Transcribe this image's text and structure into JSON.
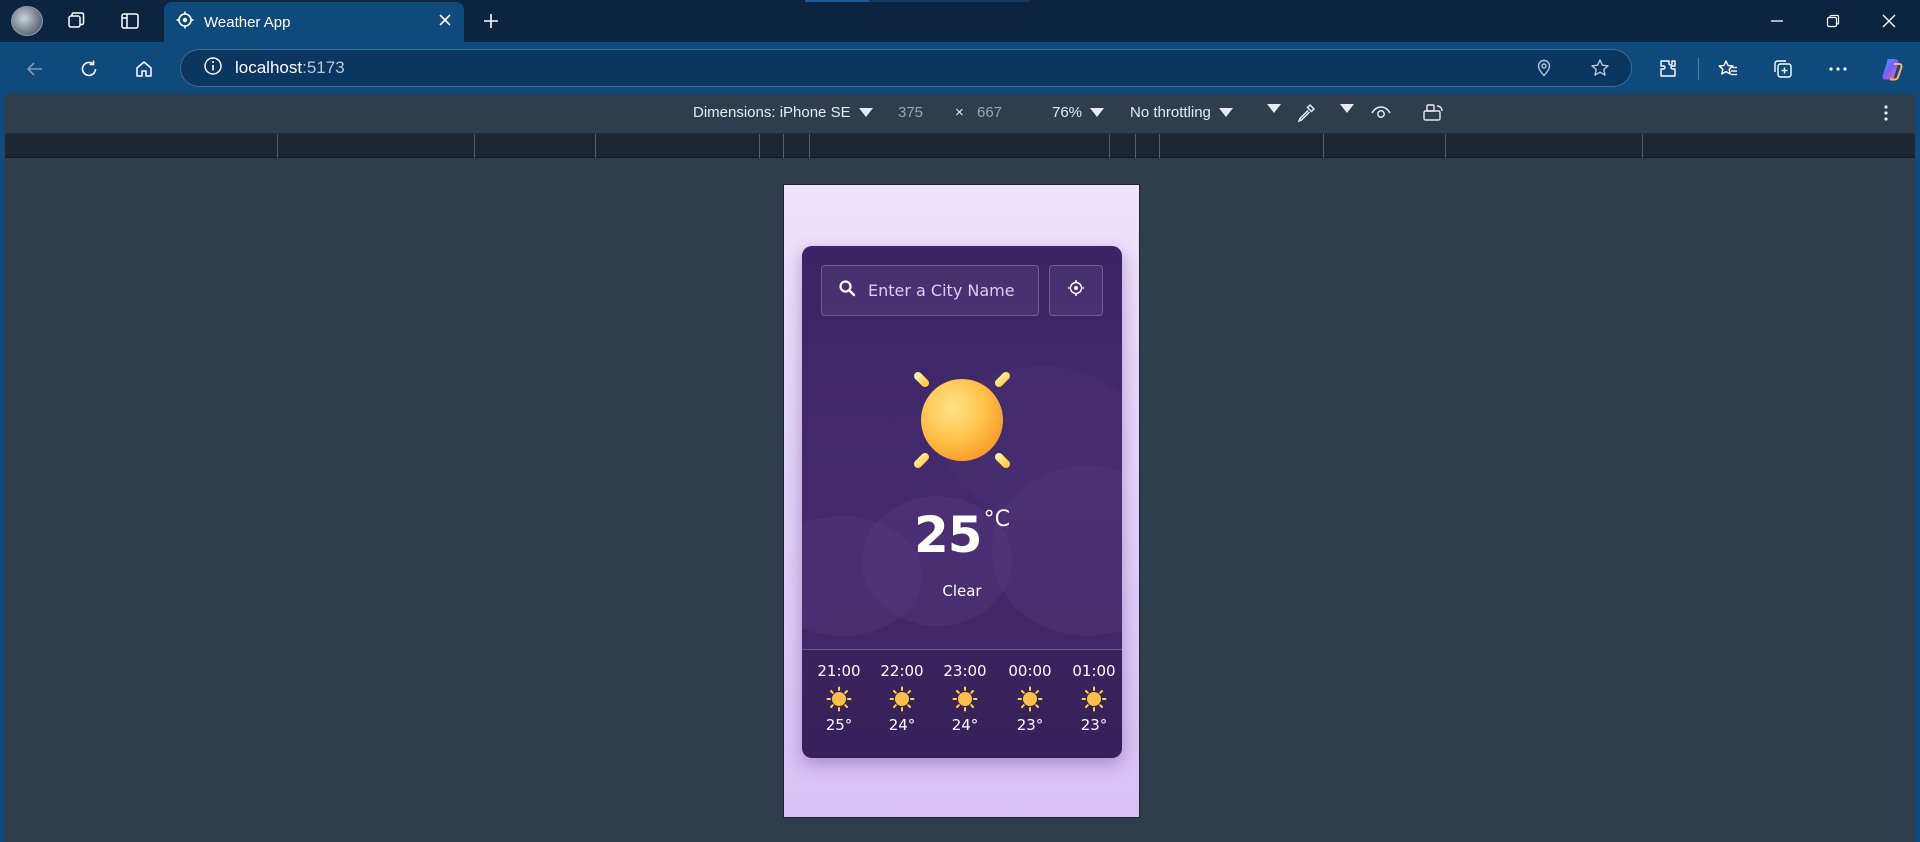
{
  "browser": {
    "tab_title": "Weather App",
    "url_host": "localhost",
    "url_port": ":5173"
  },
  "devtools": {
    "dimensions_label": "Dimensions: iPhone SE",
    "width": "375",
    "height": "667",
    "times": "×",
    "zoom": "76%",
    "throttling": "No throttling"
  },
  "app": {
    "search_placeholder": "Enter a City Name",
    "temperature": "25",
    "unit": "°C",
    "condition": "Clear",
    "hourly": [
      {
        "time": "21:00",
        "temp": "25°",
        "icon": "sun-icon"
      },
      {
        "time": "22:00",
        "temp": "24°",
        "icon": "sun-icon"
      },
      {
        "time": "23:00",
        "temp": "24°",
        "icon": "sun-icon"
      },
      {
        "time": "00:00",
        "temp": "23°",
        "icon": "sun-icon"
      },
      {
        "time": "01:00",
        "temp": "23°",
        "icon": "sun-icon"
      }
    ]
  },
  "colors": {
    "browser_chrome": "#0f4a7d",
    "devtools_bg": "#2f3d4c",
    "card": "#3d2763",
    "sun": "#ffc74a"
  }
}
